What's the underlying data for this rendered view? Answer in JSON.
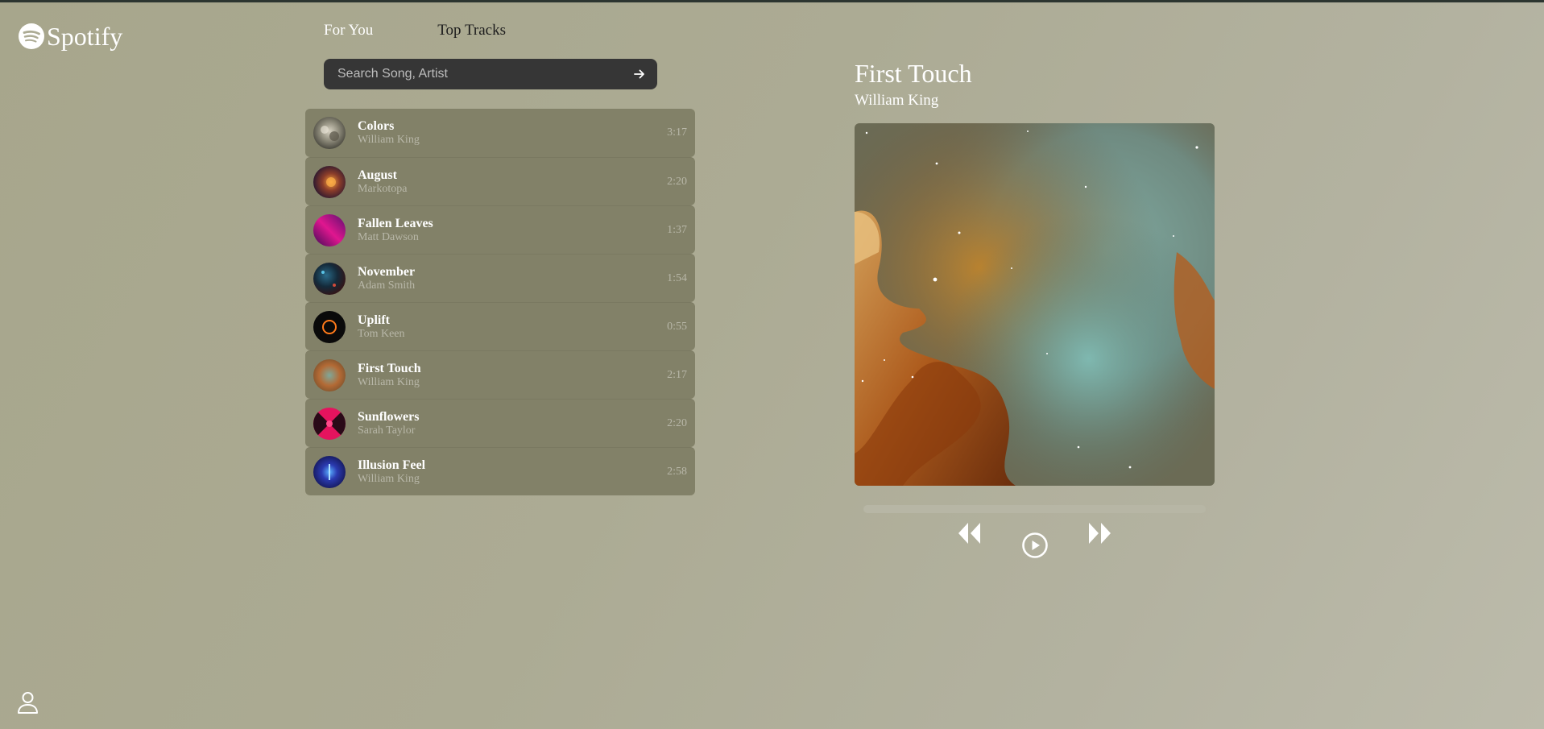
{
  "app": {
    "logo_text": "Spotify",
    "logo_icon": "spotify-logo-icon",
    "profile_icon": "user-icon"
  },
  "tabs": [
    {
      "label": "For You",
      "active": false
    },
    {
      "label": "Top Tracks",
      "active": true
    }
  ],
  "search": {
    "placeholder": "Search Song, Artist",
    "value": "",
    "button_icon": "arrow-right-icon"
  },
  "tracks": [
    {
      "title": "Colors",
      "artist": "William King",
      "duration": "3:17"
    },
    {
      "title": "August",
      "artist": "Markotopa",
      "duration": "2:20"
    },
    {
      "title": "Fallen Leaves",
      "artist": "Matt Dawson",
      "duration": "1:37"
    },
    {
      "title": "November",
      "artist": "Adam Smith",
      "duration": "1:54"
    },
    {
      "title": "Uplift",
      "artist": "Tom Keen",
      "duration": "0:55"
    },
    {
      "title": "First Touch",
      "artist": "William King",
      "duration": "2:17"
    },
    {
      "title": "Sunflowers",
      "artist": "Sarah Taylor",
      "duration": "2:20"
    },
    {
      "title": "Illusion Feel",
      "artist": "William King",
      "duration": "2:58"
    }
  ],
  "now_playing": {
    "title": "First Touch",
    "artist": "William King",
    "progress": 0,
    "controls": [
      "rewind-icon",
      "play-circle-icon",
      "fast-forward-icon"
    ]
  },
  "colors": {
    "background": "#acab94",
    "track_row": "#828168",
    "search_bg": "#363636",
    "text_primary": "#ffffff",
    "text_muted": "#b8b7a8"
  }
}
